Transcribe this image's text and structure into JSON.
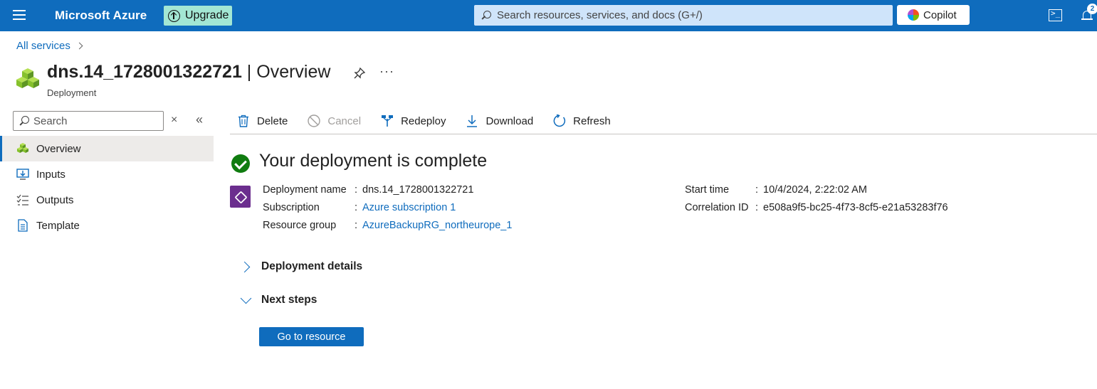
{
  "topbar": {
    "brand": "Microsoft Azure",
    "upgrade_label": "Upgrade",
    "search_placeholder": "Search resources, services, and docs (G+/)",
    "copilot_label": "Copilot",
    "notification_count": "2",
    "color": "#0f6cbd"
  },
  "breadcrumb": {
    "all_services": "All services"
  },
  "header": {
    "resource_name": "dns.14_1728001322721",
    "title_suffix": " | Overview",
    "subtitle": "Deployment",
    "more": "···"
  },
  "sidebar": {
    "search_placeholder": "Search",
    "clear": "×",
    "collapse": "«",
    "items": [
      {
        "label": "Overview",
        "icon": "cubes-icon",
        "active": true
      },
      {
        "label": "Inputs",
        "icon": "inputs-icon"
      },
      {
        "label": "Outputs",
        "icon": "outputs-icon"
      },
      {
        "label": "Template",
        "icon": "template-icon"
      }
    ]
  },
  "toolbar": {
    "delete": "Delete",
    "cancel": "Cancel",
    "redeploy": "Redeploy",
    "download": "Download",
    "refresh": "Refresh"
  },
  "content": {
    "heading": "Your deployment is complete",
    "details": {
      "deployment_name_label": "Deployment name",
      "deployment_name_value": "dns.14_1728001322721",
      "subscription_label": "Subscription",
      "subscription_value": "Azure subscription 1",
      "resource_group_label": "Resource group",
      "resource_group_value": "AzureBackupRG_northeurope_1",
      "start_time_label": "Start time",
      "start_time_value": "10/4/2024, 2:22:02 AM",
      "correlation_label": "Correlation ID",
      "correlation_value": "e508a9f5-bc25-4f73-8cf5-e21a53283f76",
      "separator": ":"
    },
    "sections": {
      "deployment_details": "Deployment details",
      "next_steps": "Next steps"
    },
    "go_to_resource": "Go to resource"
  }
}
